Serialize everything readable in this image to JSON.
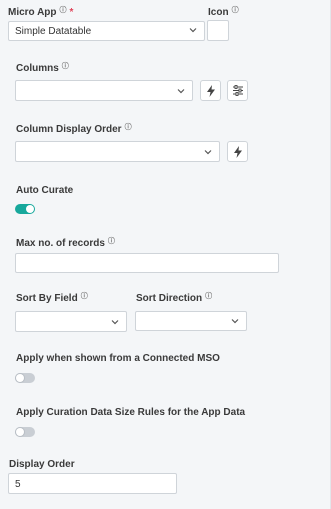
{
  "micro_app": {
    "label": "Micro App",
    "required_mark": "*",
    "value": "Simple Datatable"
  },
  "icon": {
    "label": "Icon"
  },
  "columns": {
    "label": "Columns",
    "value": ""
  },
  "column_display_order": {
    "label": "Column Display Order",
    "value": ""
  },
  "auto_curate": {
    "label": "Auto Curate",
    "enabled": true
  },
  "max_records": {
    "label": "Max no. of records",
    "value": ""
  },
  "sort_by_field": {
    "label": "Sort By Field",
    "value": ""
  },
  "sort_direction": {
    "label": "Sort Direction",
    "value": ""
  },
  "connected_mso": {
    "label": "Apply when shown from a Connected MSO",
    "enabled": false
  },
  "curation_rules": {
    "label": "Apply Curation Data Size Rules for the App Data",
    "enabled": false
  },
  "display_order": {
    "label": "Display Order",
    "value": "5"
  },
  "icons": {
    "info": "info-icon",
    "chevron": "chevron-down-icon",
    "bolt": "lightning-icon",
    "settings": "sliders-icon"
  },
  "colors": {
    "toggle_on": "#17a89c",
    "required": "#e0455a"
  }
}
